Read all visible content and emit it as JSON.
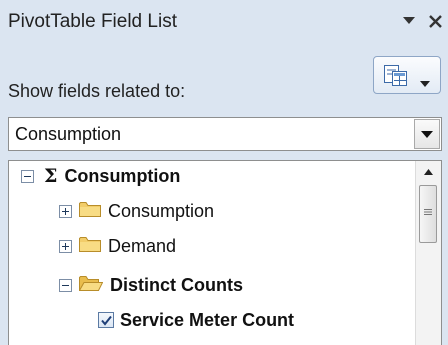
{
  "panel": {
    "title": "PivotTable Field List",
    "controls": {
      "dropdown_icon": "triangle-down-icon",
      "close_icon": "close-icon"
    },
    "layout_button_icon": "field-list-layout-icon"
  },
  "filter": {
    "label": "Show fields related to:",
    "selected_value": "Consumption"
  },
  "tree": {
    "items": [
      {
        "label": "Consumption",
        "level": 0,
        "expander": "collapse",
        "icon": "sigma-icon",
        "bold": true
      },
      {
        "label": "Consumption",
        "level": 1,
        "expander": "expand",
        "icon": "folder-icon",
        "bold": false
      },
      {
        "label": "Demand",
        "level": 1,
        "expander": "expand",
        "icon": "folder-icon",
        "bold": false
      },
      {
        "label": "Distinct Counts",
        "level": 1,
        "expander": "collapse",
        "icon": "open-folder-icon",
        "bold": true
      },
      {
        "label": "Service Meter Count",
        "level": 2,
        "checked": true,
        "bold": true
      }
    ]
  },
  "colors": {
    "pane_bg": "#dbe5f1",
    "folder": "#f0c85a",
    "checkbox_border": "#5b7aa3"
  }
}
